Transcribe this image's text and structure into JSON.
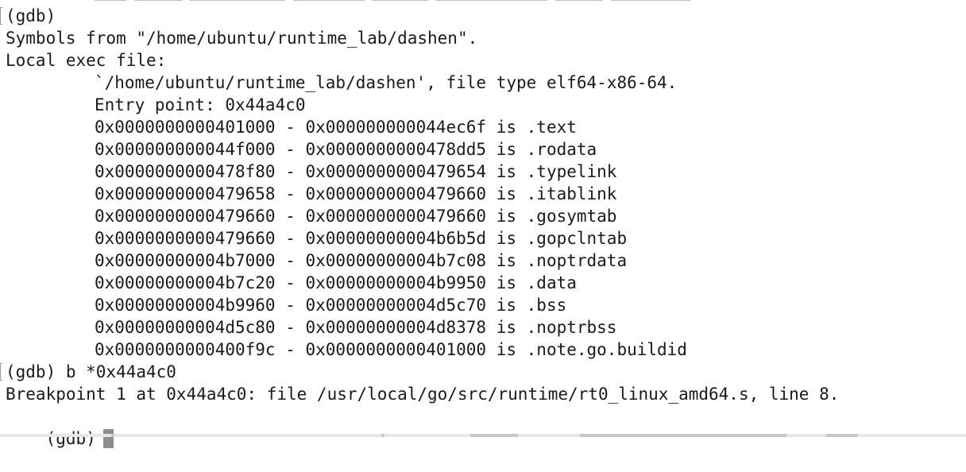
{
  "terminal": {
    "lines": [
      {
        "text": "(gdb)",
        "indent": false,
        "mark": true
      },
      {
        "text": "Symbols from \"/home/ubuntu/runtime_lab/dashen\".",
        "indent": false,
        "mark": false
      },
      {
        "text": "Local exec file:",
        "indent": false,
        "mark": false
      },
      {
        "text": "`/home/ubuntu/runtime_lab/dashen', file type elf64-x86-64.",
        "indent": true,
        "mark": false
      },
      {
        "text": "Entry point: 0x44a4c0",
        "indent": true,
        "mark": false
      },
      {
        "text": "0x0000000000401000 - 0x000000000044ec6f is .text",
        "indent": true,
        "mark": false
      },
      {
        "text": "0x000000000044f000 - 0x0000000000478dd5 is .rodata",
        "indent": true,
        "mark": false
      },
      {
        "text": "0x0000000000478f80 - 0x0000000000479654 is .typelink",
        "indent": true,
        "mark": false
      },
      {
        "text": "0x0000000000479658 - 0x0000000000479660 is .itablink",
        "indent": true,
        "mark": false
      },
      {
        "text": "0x0000000000479660 - 0x0000000000479660 is .gosymtab",
        "indent": true,
        "mark": false
      },
      {
        "text": "0x0000000000479660 - 0x00000000004b6b5d is .gopclntab",
        "indent": true,
        "mark": false
      },
      {
        "text": "0x00000000004b7000 - 0x00000000004b7c08 is .noptrdata",
        "indent": true,
        "mark": false
      },
      {
        "text": "0x00000000004b7c20 - 0x00000000004b9950 is .data",
        "indent": true,
        "mark": false
      },
      {
        "text": "0x00000000004b9960 - 0x00000000004d5c70 is .bss",
        "indent": true,
        "mark": false
      },
      {
        "text": "0x00000000004d5c80 - 0x00000000004d8378 is .noptrbss",
        "indent": true,
        "mark": false
      },
      {
        "text": "0x0000000000400f9c - 0x0000000000401000 is .note.go.buildid",
        "indent": true,
        "mark": false
      },
      {
        "text": "(gdb) b *0x44a4c0",
        "indent": false,
        "mark": true
      },
      {
        "text": "Breakpoint 1 at 0x44a4c0: file /usr/local/go/src/runtime/rt0_linux_amd64.s, line 8.",
        "indent": false,
        "mark": false
      }
    ],
    "prompt": "(gdb)",
    "colors": {
      "background": "#ffffff",
      "text": "#1a1a1a",
      "cursor": "#8e8e8e"
    }
  }
}
